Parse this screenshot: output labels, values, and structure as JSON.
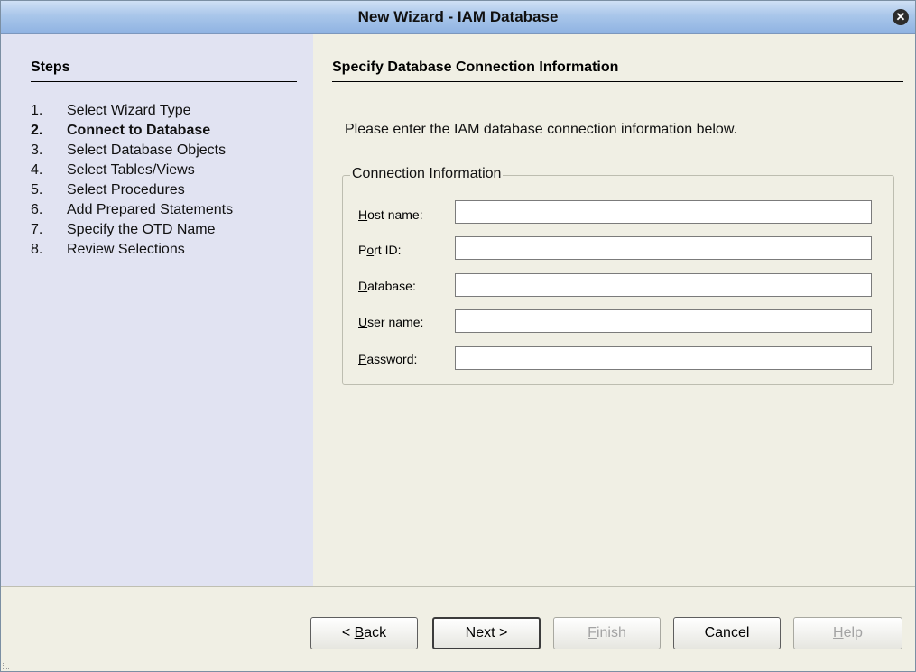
{
  "window": {
    "title": "New Wizard - IAM Database"
  },
  "steps": {
    "heading": "Steps",
    "items": [
      {
        "num": "1.",
        "label": "Select Wizard Type",
        "active": false
      },
      {
        "num": "2.",
        "label": "Connect to Database",
        "active": true
      },
      {
        "num": "3.",
        "label": "Select Database Objects",
        "active": false
      },
      {
        "num": "4.",
        "label": "Select Tables/Views",
        "active": false
      },
      {
        "num": "5.",
        "label": "Select Procedures",
        "active": false
      },
      {
        "num": "6.",
        "label": "Add Prepared Statements",
        "active": false
      },
      {
        "num": "7.",
        "label": "Specify the OTD Name",
        "active": false
      },
      {
        "num": "8.",
        "label": "Review Selections",
        "active": false
      }
    ]
  },
  "content": {
    "title": "Specify Database Connection Information",
    "instructions": "Please enter the IAM database connection information below.",
    "group_label": "Connection Information",
    "fields": [
      {
        "label": "Host name:",
        "mnemonic": "H",
        "value": ""
      },
      {
        "label": "Port ID:",
        "mnemonic": "o",
        "value": ""
      },
      {
        "label": "Database:",
        "mnemonic": "D",
        "value": ""
      },
      {
        "label": "User name:",
        "mnemonic": "U",
        "value": ""
      },
      {
        "label": "Password:",
        "mnemonic": "P",
        "value": ""
      }
    ]
  },
  "buttons": {
    "back": {
      "label": "< Back",
      "mnemonic": "B",
      "enabled": true
    },
    "next": {
      "label": "Next >",
      "enabled": true,
      "default": true
    },
    "finish": {
      "label": "Finish",
      "mnemonic": "F",
      "enabled": false
    },
    "cancel": {
      "label": "Cancel",
      "enabled": true
    },
    "help": {
      "label": "Help",
      "mnemonic": "H",
      "enabled": false
    }
  }
}
